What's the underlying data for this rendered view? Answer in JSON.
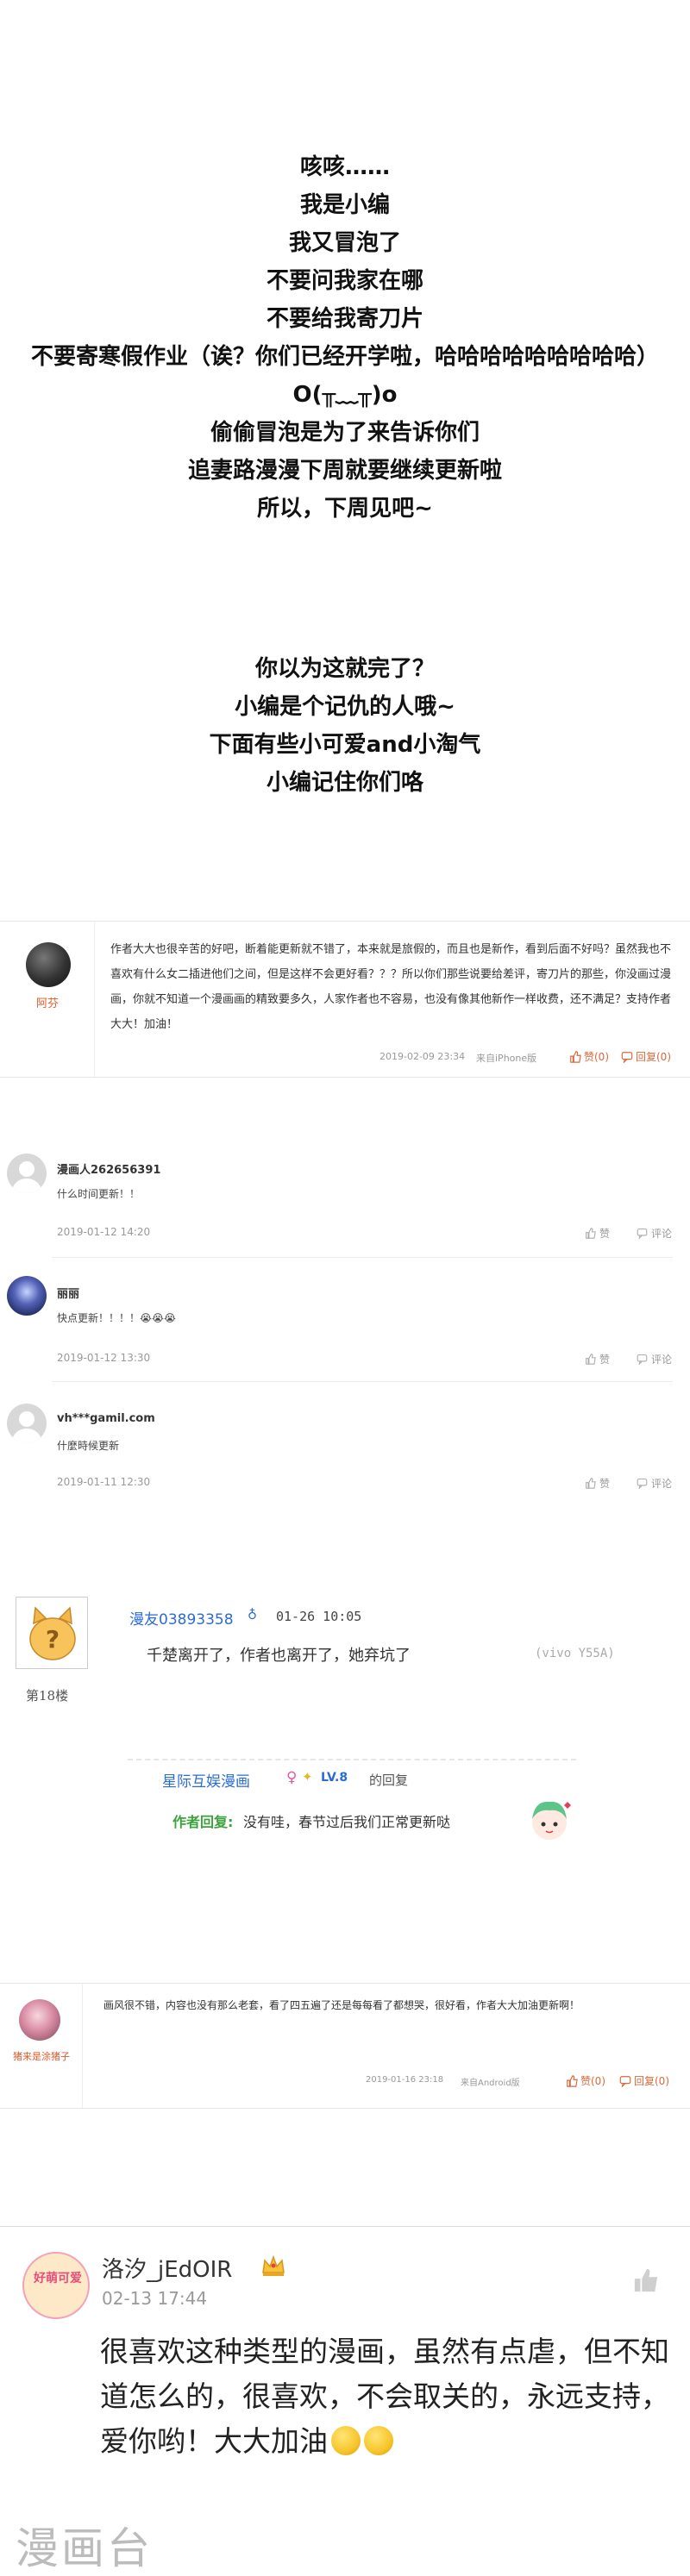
{
  "announcement": {
    "lines_1": [
      "咳咳……",
      "我是小编",
      "我又冒泡了",
      "不要问我家在哪",
      "不要给我寄刀片",
      "不要寄寒假作业（诶？你们已经开学啦，哈哈哈哈哈哈哈哈哈）",
      "O(╥﹏╥)o",
      "偷偷冒泡是为了来告诉你们",
      "追妻路漫漫下周就要继续更新啦",
      "所以，下周见吧~"
    ],
    "lines_2": [
      "你以为这就完了？",
      "小编是个记仇的人哦~",
      "下面有些小可爱and小淘气",
      "小编记住你们咯"
    ]
  },
  "card1": {
    "name": "阿芬",
    "text": "作者大大也很辛苦的好吧，断着能更新就不错了，本来就是旅假的，而且也是新作，看到后面不好吗？虽然我也不喜欢有什么女二插进他们之间，但是这样不会更好看？？？所以你们那些说要给差评，寄刀片的那些，你没画过漫画，你就不知道一个漫画画的精致要多久，人家作者也不容易，也没有像其他新作一样收费，还不满足？支持作者大大！加油！",
    "time": "2019-02-09 23:34",
    "source": "来自iPhone版",
    "like": "赞(0)",
    "reply": "回复(0)"
  },
  "comments": [
    {
      "name": "漫画人262656391",
      "text": "什么时间更新！！",
      "date": "2019-01-12 14:20",
      "like": "赞",
      "reply": "评论"
    },
    {
      "name": "丽丽",
      "text": "快点更新！！！！😭😭😭",
      "date": "2019-01-12 13:30",
      "like": "赞",
      "reply": "评论"
    },
    {
      "name": "vh***gamil.com",
      "text": "什麼時候更新",
      "date": "2019-01-11 12:30",
      "like": "赞",
      "reply": "评论"
    }
  ],
  "forum": {
    "floor": "第18楼",
    "nick": "漫友03893358",
    "time": "01-26 10:05",
    "body": "千楚离开了，作者也离开了，她弃坑了",
    "device": "(vivo Y55A)",
    "reply_name": "星际互娱漫画",
    "reply_level": "LV.8",
    "reply_word": "的回复",
    "author_label": "作者回复:",
    "author_text": "没有哇，春节过后我们正常更新哒"
  },
  "card2": {
    "name": "猪来是涂猪子",
    "text": "画风很不错，内容也没有那么老套，看了四五遍了还是每每看了都想哭，很好看，作者大大加油更新啊！",
    "time": "2019-01-16 23:18",
    "source": "来自Android版",
    "like": "赞(0)",
    "reply": "回复(0)"
  },
  "card3": {
    "name": "洛汐_jEdOIR",
    "date": "02-13 17:44",
    "body": "很喜欢这种类型的漫画，虽然有点虐，但不知道怎么的，很喜欢，不会取关的，永远支持，爱你哟！大大加油",
    "avatar_text": "好萌可爱",
    "watermark": "漫画台"
  }
}
